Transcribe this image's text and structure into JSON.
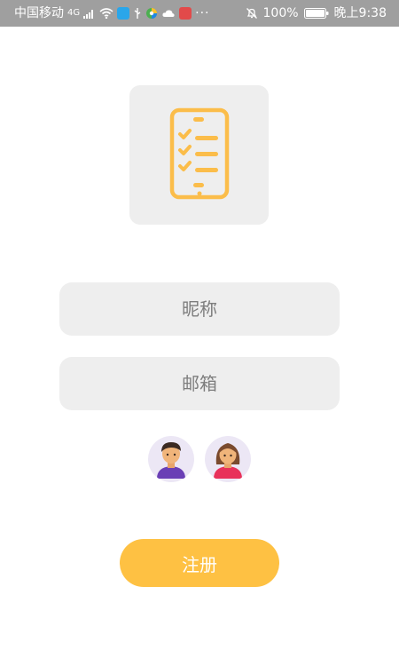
{
  "status_bar": {
    "carrier": "中国移动",
    "signal_type": "4G",
    "more_indicator": "···",
    "battery": "100%",
    "time": "晚上9:38",
    "icons": [
      "signal-icon",
      "wifi-icon",
      "notification-app-icon",
      "usb-icon",
      "browser-icon",
      "cloud-icon",
      "mail-app-icon",
      "mute-icon",
      "battery-icon"
    ]
  },
  "logo": {
    "icon": "checklist-icon",
    "accent_color": "#fbbd4a",
    "background_color": "#eeeeee"
  },
  "form": {
    "nickname_placeholder": "昵称",
    "email_placeholder": "邮箱",
    "nickname_value": "",
    "email_value": ""
  },
  "avatars": {
    "male_icon": "male-avatar-icon",
    "female_icon": "female-avatar-icon"
  },
  "register": {
    "label": "注册",
    "color": "#fec143"
  }
}
